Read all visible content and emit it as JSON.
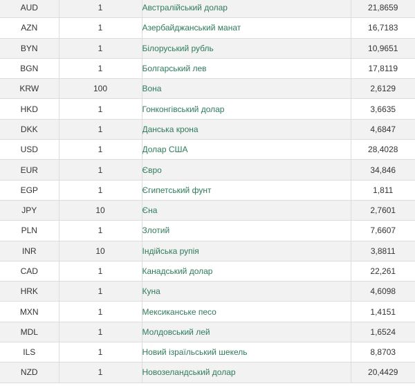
{
  "rates": [
    {
      "code": "AUD",
      "units": "1",
      "name": "Австралійський долар",
      "rate": "21,8659"
    },
    {
      "code": "AZN",
      "units": "1",
      "name": "Азербайджанський манат",
      "rate": "16,7183"
    },
    {
      "code": "BYN",
      "units": "1",
      "name": "Білоруський рубль",
      "rate": "10,9651"
    },
    {
      "code": "BGN",
      "units": "1",
      "name": "Болгарський лев",
      "rate": "17,8119"
    },
    {
      "code": "KRW",
      "units": "100",
      "name": "Вона",
      "rate": "2,6129"
    },
    {
      "code": "HKD",
      "units": "1",
      "name": "Гонконгівський долар",
      "rate": "3,6635"
    },
    {
      "code": "DKK",
      "units": "1",
      "name": "Данська крона",
      "rate": "4,6847"
    },
    {
      "code": "USD",
      "units": "1",
      "name": "Долар США",
      "rate": "28,4028"
    },
    {
      "code": "EUR",
      "units": "1",
      "name": "Євро",
      "rate": "34,846"
    },
    {
      "code": "EGP",
      "units": "1",
      "name": "Єгипетський фунт",
      "rate": "1,811"
    },
    {
      "code": "JPY",
      "units": "10",
      "name": "Єна",
      "rate": "2,7601"
    },
    {
      "code": "PLN",
      "units": "1",
      "name": "Злотий",
      "rate": "7,6607"
    },
    {
      "code": "INR",
      "units": "10",
      "name": "Індійська рупія",
      "rate": "3,8811"
    },
    {
      "code": "CAD",
      "units": "1",
      "name": "Канадський долар",
      "rate": "22,261"
    },
    {
      "code": "HRK",
      "units": "1",
      "name": "Куна",
      "rate": "4,6098"
    },
    {
      "code": "MXN",
      "units": "1",
      "name": "Мексиканське песо",
      "rate": "1,4151"
    },
    {
      "code": "MDL",
      "units": "1",
      "name": "Молдовський лей",
      "rate": "1,6524"
    },
    {
      "code": "ILS",
      "units": "1",
      "name": "Новий ізраїльський шекель",
      "rate": "8,8703"
    },
    {
      "code": "NZD",
      "units": "1",
      "name": "Новозеландський долар",
      "rate": "20,4429"
    }
  ]
}
